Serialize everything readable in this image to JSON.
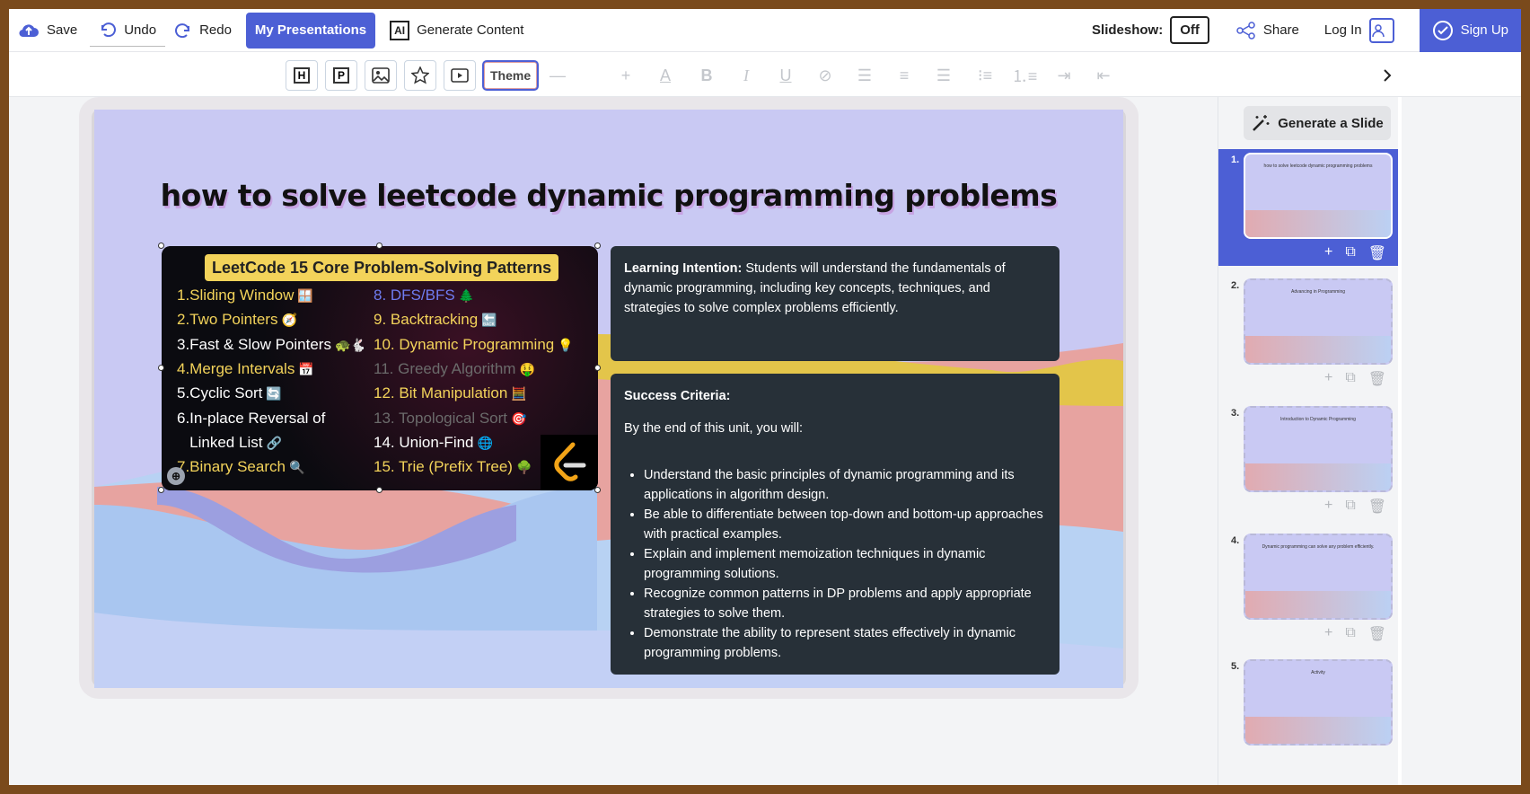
{
  "topbar": {
    "save_label": "Save",
    "undo_label": "Undo",
    "redo_label": "Redo",
    "my_presentations_label": "My Presentations",
    "generate_content_label": "Generate Content",
    "ai_badge": "AI",
    "slideshow_label": "Slideshow:",
    "slideshow_state": "Off",
    "share_label": "Share",
    "login_label": "Log In",
    "signup_label": "Sign Up"
  },
  "toolbar": {
    "theme_label": "Theme"
  },
  "slide": {
    "title": "how to solve leetcode dynamic programming problems",
    "image": {
      "heading": "LeetCode 15 Core Problem-Solving Patterns",
      "patterns_left": [
        {
          "text": "1.Sliding Window",
          "color": "#f3d35a",
          "emoji": "🪟"
        },
        {
          "text": "2.Two Pointers",
          "color": "#f3d35a",
          "emoji": "🧭"
        },
        {
          "text": "3.Fast & Slow Pointers",
          "color": "#ffffff",
          "emoji": "🐢🐇"
        },
        {
          "text": "4.Merge Intervals",
          "color": "#f3d35a",
          "emoji": "📅"
        },
        {
          "text": "5.Cyclic Sort",
          "color": "#ffffff",
          "emoji": "🔄"
        },
        {
          "text": "6.In-place Reversal of",
          "color": "#ffffff",
          "emoji": ""
        },
        {
          "text": "   Linked List",
          "color": "#ffffff",
          "emoji": "🔗"
        },
        {
          "text": "7.Binary Search",
          "color": "#f3d35a",
          "emoji": "🔍"
        }
      ],
      "patterns_right": [
        {
          "text": "8. DFS/BFS",
          "color": "#6f7cf0",
          "emoji": "🌲"
        },
        {
          "text": "9. Backtracking",
          "color": "#f3d35a",
          "emoji": "🔙"
        },
        {
          "text": "10. Dynamic Programming",
          "color": "#f3d35a",
          "emoji": "💡"
        },
        {
          "text": "11. Greedy Algorithm",
          "color": "#6b6b6b",
          "emoji": "🤑"
        },
        {
          "text": "12. Bit Manipulation",
          "color": "#f3d35a",
          "emoji": "🧮"
        },
        {
          "text": "13. Topological Sort",
          "color": "#6b6b6b",
          "emoji": "🎯"
        },
        {
          "text": "14. Union-Find",
          "color": "#ffffff",
          "emoji": "🌐"
        },
        {
          "text": "15. Trie (Prefix Tree)",
          "color": "#f3d35a",
          "emoji": "🌳"
        }
      ]
    },
    "intention": {
      "label": "Learning Intention:",
      "text": " Students will understand the fundamentals of dynamic programming, including key concepts, techniques, and strategies to solve complex problems efficiently."
    },
    "criteria": {
      "label": "Success Criteria:",
      "intro": "By the end of this unit, you will:",
      "items": [
        "Understand the basic principles of dynamic programming and its applications in algorithm design.",
        "Be able to differentiate between top-down and bottom-up approaches with practical examples.",
        "Explain and implement memoization techniques in dynamic programming solutions.",
        "Recognize common patterns in DP problems and apply appropriate strategies to solve them.",
        "Demonstrate the ability to represent states effectively in dynamic programming problems."
      ]
    }
  },
  "sidebar": {
    "generate_slide_label": "Generate a Slide",
    "thumbnails": [
      {
        "num": "1.",
        "caption": "how to solve leetcode dynamic programming problems"
      },
      {
        "num": "2.",
        "caption": "Advancing in Programming"
      },
      {
        "num": "3.",
        "caption": "Introduction to Dynamic Programming"
      },
      {
        "num": "4.",
        "caption": "Dynamic programming can solve any problem efficiently."
      },
      {
        "num": "5.",
        "caption": "Activity"
      }
    ]
  },
  "colors": {
    "accent": "#4c5fd5",
    "panel": "#273038",
    "slide_bg": "#c9c9f3",
    "highlight_yellow": "#f3d35a"
  }
}
